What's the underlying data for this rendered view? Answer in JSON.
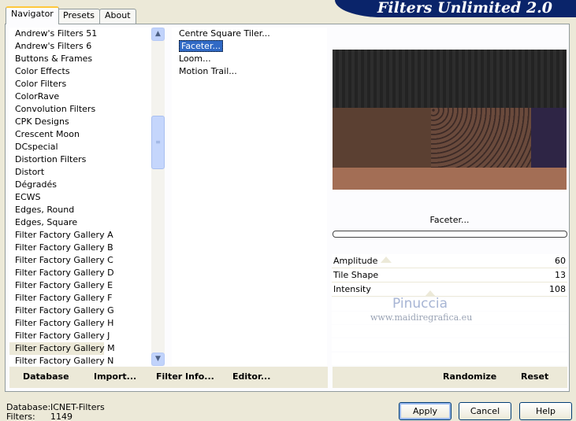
{
  "app": {
    "title": "Filters Unlimited 2.0"
  },
  "tabs": [
    {
      "label": "Navigator",
      "active": true
    },
    {
      "label": "Presets",
      "active": false
    },
    {
      "label": "About",
      "active": false
    }
  ],
  "categories": [
    "Andrew's Filters 51",
    "Andrew's Filters 6",
    "Buttons & Frames",
    "Color Effects",
    "Color Filters",
    "ColorRave",
    "Convolution Filters",
    "CPK Designs",
    "Crescent Moon",
    "DCspecial",
    "Distortion Filters",
    "Distort",
    "Dégradés",
    "ECWS",
    "Edges, Round",
    "Edges, Square",
    "Filter Factory Gallery A",
    "Filter Factory Gallery B",
    "Filter Factory Gallery C",
    "Filter Factory Gallery D",
    "Filter Factory Gallery E",
    "Filter Factory Gallery F",
    "Filter Factory Gallery G",
    "Filter Factory Gallery H",
    "Filter Factory Gallery J",
    "Filter Factory Gallery M",
    "Filter Factory Gallery N"
  ],
  "selected_category": "Filter Factory Gallery M",
  "filters": [
    "Centre Square Tiler...",
    "Faceter...",
    "Loom...",
    "Motion Trail..."
  ],
  "selected_filter": "Faceter...",
  "preview": {
    "filter_name": "Faceter..."
  },
  "params": [
    {
      "label": "Amplitude",
      "value": "60"
    },
    {
      "label": "Tile Shape",
      "value": "13"
    },
    {
      "label": "Intensity",
      "value": "108"
    }
  ],
  "watermark": {
    "name": "Pinuccia",
    "url": "www.maidiregrafica.eu"
  },
  "actions": {
    "database": "Database",
    "import": "Import...",
    "filter_info": "Filter Info...",
    "editor": "Editor...",
    "randomize": "Randomize",
    "reset": "Reset"
  },
  "footer": {
    "database_label": "Database:",
    "database_value": "ICNET-Filters",
    "filters_label": "Filters:",
    "filters_value": "1149",
    "apply": "Apply",
    "cancel": "Cancel",
    "help": "Help"
  },
  "icons": {
    "scroll_up": "chevron-up-icon",
    "scroll_down": "chevron-down-icon",
    "grip": "scroll-grip-icon"
  }
}
